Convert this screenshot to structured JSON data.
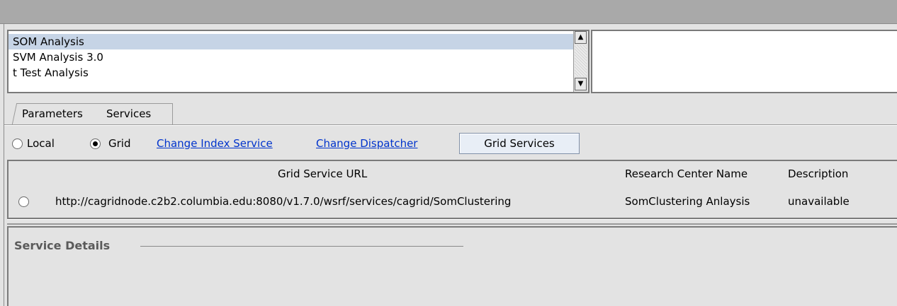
{
  "analysis_list": {
    "items": [
      "SOM Analysis",
      "SVM Analysis 3.0",
      "t Test Analysis"
    ],
    "selected_index": 0,
    "scroll_up_glyph": "▲",
    "scroll_down_glyph": "▼"
  },
  "tabs": [
    {
      "label": "Parameters"
    },
    {
      "label": "Services",
      "selected": true
    }
  ],
  "mode": {
    "local_label": "Local",
    "grid_label": "Grid",
    "selected": "Grid",
    "change_index_link": "Change Index Service",
    "change_dispatcher_link": "Change Dispatcher",
    "grid_services_button": "Grid Services"
  },
  "services_table": {
    "headers": [
      "Grid Service URL",
      "Research Center Name",
      "Description"
    ],
    "rows": [
      {
        "url": "http://cagridnode.c2b2.columbia.edu:8080/v1.7.0/wsrf/services/cagrid/SomClustering",
        "center": "SomClustering Anlaysis",
        "description": "unavailable",
        "selected": false
      }
    ]
  },
  "service_details": {
    "title": "Service Details"
  },
  "colors": {
    "selection": "#c6d4e6",
    "link": "#0033cc",
    "panel": "#e3e3e3",
    "topbar": "#a9a9a9"
  },
  "icons": {
    "scroll_up": "arrow-up-icon",
    "scroll_down": "arrow-down-icon"
  }
}
